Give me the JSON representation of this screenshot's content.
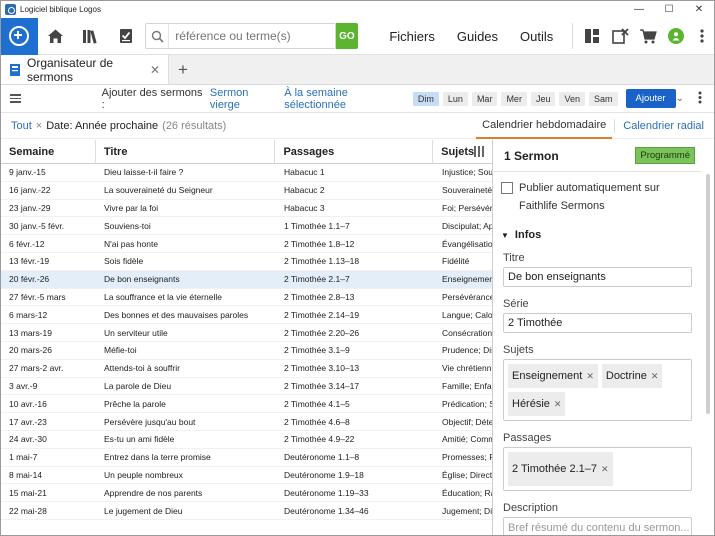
{
  "window": {
    "title": "Logiciel biblique Logos",
    "min": "—",
    "max": "☐",
    "close": "✕"
  },
  "toolbar": {
    "search_placeholder": "référence ou terme(s)",
    "go_label": "GO",
    "nav": [
      "Fichiers",
      "Guides",
      "Outils"
    ]
  },
  "tab": {
    "title": "Organisateur de sermons",
    "close": "✕",
    "add": "+"
  },
  "panel_toolbar": {
    "add_label": "Ajouter des sermons :",
    "blank_sermon": "Sermon vierge",
    "selected_week": "À la semaine sélectionnée",
    "days": [
      "Dim",
      "Lun",
      "Mar",
      "Mer",
      "Jeu",
      "Ven",
      "Sam"
    ],
    "selected_day": "Dim",
    "add_button": "Ajouter"
  },
  "filter": {
    "all": "Tout",
    "chip": "Date: Année prochaine",
    "results": "(26 résultats)",
    "views": [
      "Calendrier hebdomadaire",
      "Calendrier radial"
    ]
  },
  "table": {
    "headers": [
      "Semaine",
      "Titre",
      "Passages",
      "Sujets"
    ],
    "rows": [
      [
        "9 janv.-15",
        "Dieu laisse-t-il faire ?",
        "Habacuc 1",
        "Injustice; Souf"
      ],
      [
        "16 janv.-22",
        "La souveraineté du Seigneur",
        "Habacuc 2",
        "Souveraineté;"
      ],
      [
        "23 janv.-29",
        "Vivre par la foi",
        "Habacuc 3",
        "Foi; Persévéra"
      ],
      [
        "30 janv.-5 févr.",
        "Souviens-toi",
        "1 Timothée 1.1–7",
        "Discipulat; Ap"
      ],
      [
        "6 févr.-12",
        "N'ai pas honte",
        "2 Timothée 1.8–12",
        "Évangélisatio"
      ],
      [
        "13 févr.-19",
        "Sois fidèle",
        "2 Timothée 1.13–18",
        "Fidélité"
      ],
      [
        "20 févr.-26",
        "De bon enseignants",
        "2 Timothée 2.1–7",
        "Enseignemen"
      ],
      [
        "27 févr.-5 mars",
        "La souffrance et la vie éternelle",
        "2 Timothée 2.8–13",
        "Persévérance"
      ],
      [
        "6 mars-12",
        "Des bonnes et des mauvaises paroles",
        "2 Timothée 2.14–19",
        "Langue; Calo"
      ],
      [
        "13 mars-19",
        "Un serviteur utile",
        "2 Timothée 2.20–26",
        "Consécration"
      ],
      [
        "20 mars-26",
        "Méfie-toi",
        "2 Timothée 3.1–9",
        "Prudence; Dis"
      ],
      [
        "27 mars-2 avr.",
        "Attends-toi à souffrir",
        "2 Timothée 3.10–13",
        "Vie chrétienn"
      ],
      [
        "3 avr.-9",
        "La parole de Dieu",
        "2 Timothée 3.14–17",
        "Famille; Enfa"
      ],
      [
        "10 avr.-16",
        "Prêche la parole",
        "2 Timothée 4.1–5",
        "Prédication; S"
      ],
      [
        "17 avr.-23",
        "Persévère jusqu'au bout",
        "2 Timothée 4.6–8",
        "Objectif; Déte"
      ],
      [
        "24 avr.-30",
        "Es-tu un ami fidèle",
        "2 Timothée 4.9–22",
        "Amitié; Comm"
      ],
      [
        "1 mai-7",
        "Entrez dans la terre promise",
        "Deutéronome 1.1–8",
        "Promesses; F"
      ],
      [
        "8 mai-14",
        "Un peuple nombreux",
        "Deutéronome 1.9–18",
        "Église; Direct"
      ],
      [
        "15 mai-21",
        "Apprendre de nos parents",
        "Deutéronome 1.19–33",
        "Éducation; Ra"
      ],
      [
        "22 mai-28",
        "Le jugement de Dieu",
        "Deutéronome 1.34–46",
        "Jugement; Di"
      ]
    ],
    "selected_index": 6
  },
  "detail": {
    "heading": "1 Sermon",
    "status": "Programmé",
    "publish_label": "Publier automatiquement sur Faithlife Sermons",
    "section": "Infos",
    "title_label": "Titre",
    "title_value": "De bon enseignants",
    "series_label": "Série",
    "series_value": "2 Timothée",
    "subjects_label": "Sujets",
    "subjects": [
      "Enseignement",
      "Doctrine",
      "Hérésie"
    ],
    "passages_label": "Passages",
    "passages": [
      "2 Timothée 2.1–7"
    ],
    "description_label": "Description",
    "description_placeholder": "Bref résumé du contenu du sermon..."
  },
  "colors": {
    "brand": "#1f6fd1",
    "go": "#5cb531",
    "accent_tab": "#e07b2a",
    "status": "#7ac35a",
    "selected_row": "#e3eef9"
  }
}
